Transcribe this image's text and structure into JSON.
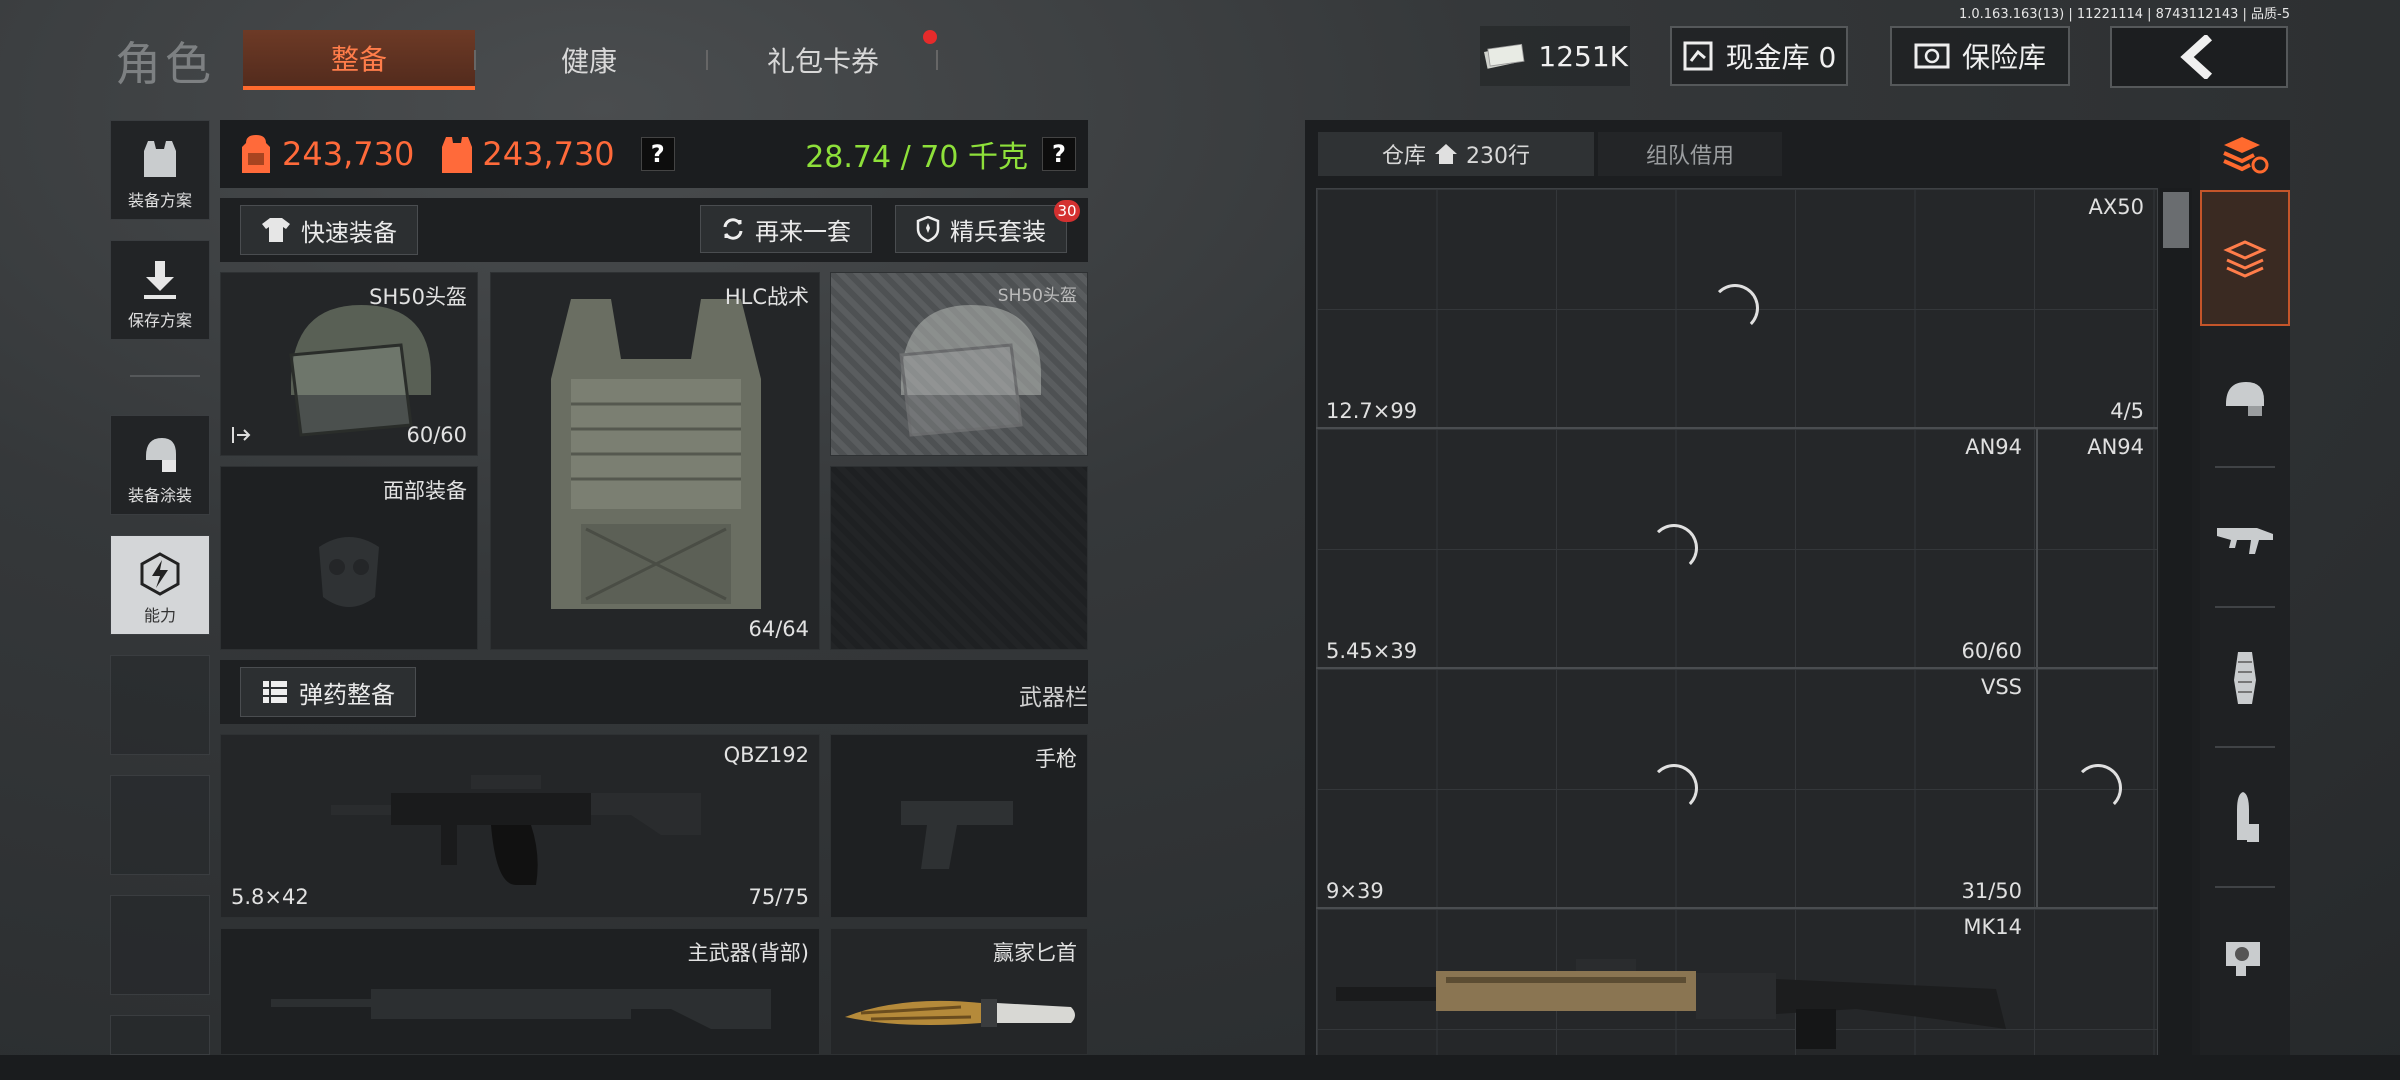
{
  "version_info": "1.0.163.163(13) | 11221114 | 8743112143 | 品质-5",
  "header": {
    "title": "角色",
    "tabs": [
      {
        "label": "整备",
        "active": true
      },
      {
        "label": "健康",
        "active": false
      },
      {
        "label": "礼包卡券",
        "active": false,
        "has_dot": true
      }
    ],
    "money": "1251K",
    "cash_vault_label": "现金库 0",
    "safe_label": "保险库"
  },
  "sidebar": {
    "items": [
      {
        "label": "装备方案",
        "icon": "vest-icon"
      },
      {
        "label": "保存方案",
        "icon": "download-icon"
      },
      {
        "label": "装备涂装",
        "icon": "paint-icon"
      },
      {
        "label": "能力",
        "icon": "ability-icon"
      }
    ]
  },
  "stats": {
    "value1": "243,730",
    "value2": "243,730",
    "weight": "28.74 / 70 千克",
    "help": "?"
  },
  "actions": {
    "quick_equip": "快速装备",
    "again": "再来一套",
    "elite": "精兵套装",
    "elite_badge": "30"
  },
  "gear": {
    "helmet": {
      "name": "SH50头盔",
      "durability": "60/60"
    },
    "armor": {
      "name": "HLC战术",
      "durability": "64/64"
    },
    "helmet_ghost": {
      "name": "SH50头盔"
    },
    "face": {
      "name": "面部装备"
    }
  },
  "ammo_section": {
    "label": "弹药整备",
    "weapon_bar": "武器栏"
  },
  "weapons": {
    "primary": {
      "name": "QBZ192",
      "caliber": "5.8×42",
      "ammo": "75/75"
    },
    "pistol": {
      "name": "手枪"
    },
    "back": {
      "name": "主武器(背部)"
    },
    "knife": {
      "name": "赢家匕首"
    }
  },
  "warehouse": {
    "tab_label": "仓库",
    "rows_label": "230行",
    "team_tab": "组队借用",
    "items": [
      {
        "name": "AX50",
        "caliber": "12.7×99",
        "count": "4/5"
      },
      {
        "name": "AN94",
        "caliber": "5.45×39",
        "count": "60/60"
      },
      {
        "name": "AN94"
      },
      {
        "name": "VSS",
        "caliber": "9×39",
        "count": "31/50"
      },
      {
        "name": "MK14"
      }
    ]
  },
  "colors": {
    "accent": "#ff6a2e",
    "weight_green": "#8ee03a",
    "badge_red": "#e62b2b"
  }
}
